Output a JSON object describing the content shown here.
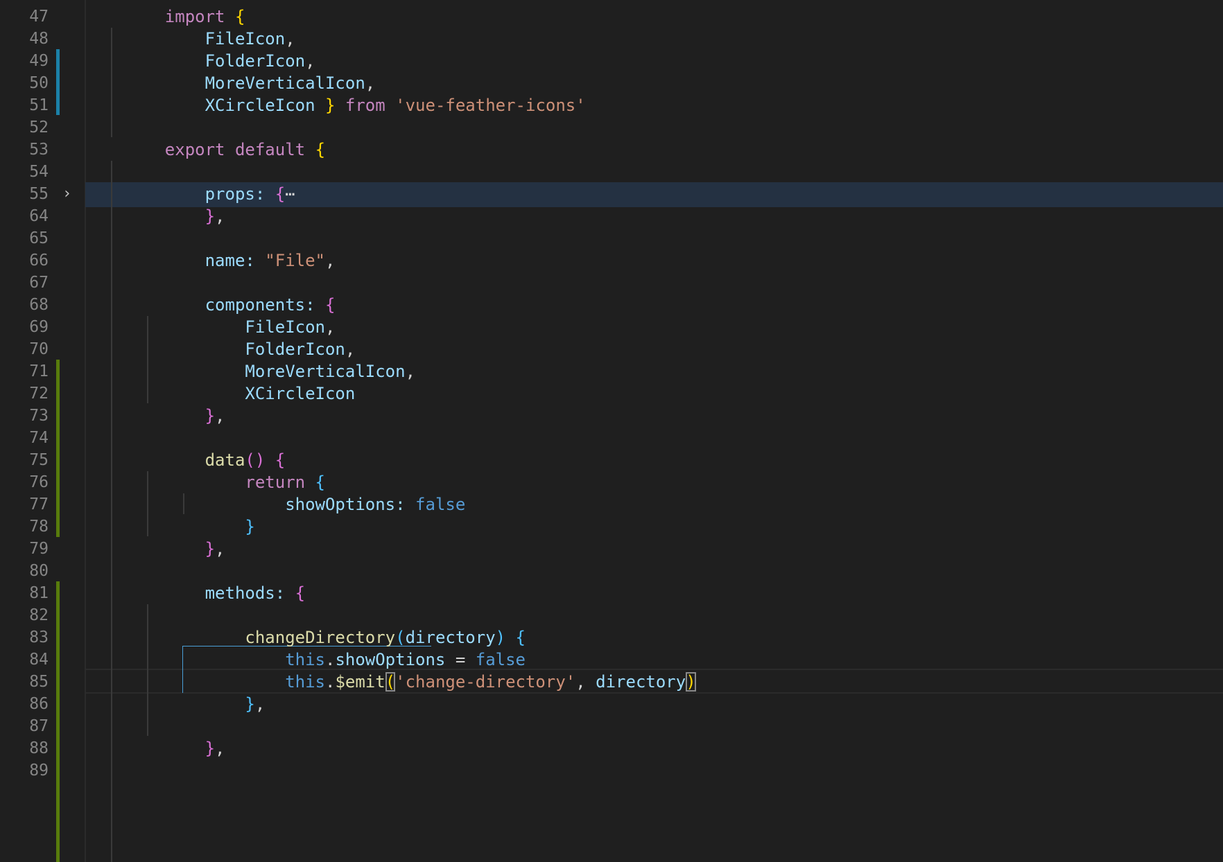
{
  "editor": {
    "colors": {
      "background": "#1f1f1f",
      "line_number": "#858585",
      "change_modified": "#1b81a8",
      "change_added": "#587c0c",
      "highlight": "#243142"
    },
    "lines": [
      {
        "n": "47",
        "tokens": [
          [
            "    ",
            "w"
          ],
          [
            "import",
            "p"
          ],
          [
            " ",
            "w"
          ],
          [
            "{",
            "y"
          ]
        ]
      },
      {
        "n": "48",
        "tokens": [
          [
            "        ",
            "w"
          ],
          [
            "FileIcon",
            "b"
          ],
          [
            ",",
            "w"
          ]
        ]
      },
      {
        "n": "49",
        "tokens": [
          [
            "        ",
            "w"
          ],
          [
            "FolderIcon",
            "b"
          ],
          [
            ",",
            "w"
          ]
        ]
      },
      {
        "n": "50",
        "tokens": [
          [
            "        ",
            "w"
          ],
          [
            "MoreVerticalIcon",
            "b"
          ],
          [
            ",",
            "w"
          ]
        ]
      },
      {
        "n": "51",
        "tokens": [
          [
            "        ",
            "w"
          ],
          [
            "XCircleIcon",
            "b"
          ],
          [
            " ",
            "w"
          ],
          [
            "}",
            "y"
          ],
          [
            " ",
            "w"
          ],
          [
            "from",
            "p"
          ],
          [
            " ",
            "w"
          ],
          [
            "'vue-feather-icons'",
            "o"
          ]
        ]
      },
      {
        "n": "52",
        "tokens": []
      },
      {
        "n": "53",
        "tokens": [
          [
            "    ",
            "w"
          ],
          [
            "export",
            "p"
          ],
          [
            " ",
            "w"
          ],
          [
            "default",
            "p"
          ],
          [
            " ",
            "w"
          ],
          [
            "{",
            "y"
          ]
        ]
      },
      {
        "n": "54",
        "tokens": []
      },
      {
        "n": "55",
        "tokens": [
          [
            "        ",
            "w"
          ],
          [
            "props",
            "b"
          ],
          [
            ": ",
            "b"
          ],
          [
            "{",
            "pk"
          ],
          [
            "⋯",
            "w"
          ]
        ]
      },
      {
        "n": "64",
        "tokens": [
          [
            "        ",
            "w"
          ],
          [
            "}",
            "pk"
          ],
          [
            ",",
            "w"
          ]
        ]
      },
      {
        "n": "65",
        "tokens": []
      },
      {
        "n": "66",
        "tokens": [
          [
            "        ",
            "w"
          ],
          [
            "name",
            "b"
          ],
          [
            ": ",
            "b"
          ],
          [
            "\"File\"",
            "o"
          ],
          [
            ",",
            "w"
          ]
        ]
      },
      {
        "n": "67",
        "tokens": []
      },
      {
        "n": "68",
        "tokens": [
          [
            "        ",
            "w"
          ],
          [
            "components",
            "b"
          ],
          [
            ": ",
            "b"
          ],
          [
            "{",
            "pk"
          ]
        ]
      },
      {
        "n": "69",
        "tokens": [
          [
            "            ",
            "w"
          ],
          [
            "FileIcon",
            "b"
          ],
          [
            ",",
            "w"
          ]
        ]
      },
      {
        "n": "70",
        "tokens": [
          [
            "            ",
            "w"
          ],
          [
            "FolderIcon",
            "b"
          ],
          [
            ",",
            "w"
          ]
        ]
      },
      {
        "n": "71",
        "tokens": [
          [
            "            ",
            "w"
          ],
          [
            "MoreVerticalIcon",
            "b"
          ],
          [
            ",",
            "w"
          ]
        ]
      },
      {
        "n": "72",
        "tokens": [
          [
            "            ",
            "w"
          ],
          [
            "XCircleIcon",
            "b"
          ]
        ]
      },
      {
        "n": "73",
        "tokens": [
          [
            "        ",
            "w"
          ],
          [
            "}",
            "pk"
          ],
          [
            ",",
            "w"
          ]
        ]
      },
      {
        "n": "74",
        "tokens": []
      },
      {
        "n": "75",
        "tokens": [
          [
            "        ",
            "w"
          ],
          [
            "data",
            "f"
          ],
          [
            "()",
            "pk"
          ],
          [
            " ",
            "w"
          ],
          [
            "{",
            "pk"
          ]
        ]
      },
      {
        "n": "76",
        "tokens": [
          [
            "            ",
            "w"
          ],
          [
            "return",
            "p"
          ],
          [
            " ",
            "w"
          ],
          [
            "{",
            "cb"
          ]
        ]
      },
      {
        "n": "77",
        "tokens": [
          [
            "                ",
            "w"
          ],
          [
            "showOptions",
            "b"
          ],
          [
            ": ",
            "b"
          ],
          [
            "false",
            "bo"
          ]
        ]
      },
      {
        "n": "78",
        "tokens": [
          [
            "            ",
            "w"
          ],
          [
            "}",
            "cb"
          ]
        ]
      },
      {
        "n": "79",
        "tokens": [
          [
            "        ",
            "w"
          ],
          [
            "}",
            "pk"
          ],
          [
            ",",
            "w"
          ]
        ]
      },
      {
        "n": "80",
        "tokens": []
      },
      {
        "n": "81",
        "tokens": [
          [
            "        ",
            "w"
          ],
          [
            "methods",
            "b"
          ],
          [
            ": ",
            "b"
          ],
          [
            "{",
            "pk"
          ]
        ]
      },
      {
        "n": "82",
        "tokens": []
      },
      {
        "n": "83",
        "tokens": [
          [
            "            ",
            "w"
          ],
          [
            "changeDirectory",
            "f"
          ],
          [
            "(",
            "cb"
          ],
          [
            "directory",
            "b"
          ],
          [
            ")",
            "cb"
          ],
          [
            " ",
            "w"
          ],
          [
            "{",
            "cb"
          ]
        ]
      },
      {
        "n": "84",
        "tokens": [
          [
            "                ",
            "w"
          ],
          [
            "this",
            "bo"
          ],
          [
            ".",
            "w"
          ],
          [
            "showOptions",
            "b"
          ],
          [
            " = ",
            "w"
          ],
          [
            "false",
            "bo"
          ]
        ]
      },
      {
        "n": "85",
        "tokens": [
          [
            "                ",
            "w"
          ],
          [
            "this",
            "bo"
          ],
          [
            ".",
            "w"
          ],
          [
            "$emit",
            "f"
          ],
          [
            "(",
            "ybox"
          ],
          [
            "'change-directory'",
            "o"
          ],
          [
            ", ",
            "w"
          ],
          [
            "directory",
            "b"
          ],
          [
            ")",
            "ybox"
          ]
        ]
      },
      {
        "n": "86",
        "tokens": [
          [
            "            ",
            "w"
          ],
          [
            "}",
            "cb"
          ],
          [
            ",",
            "w"
          ]
        ]
      },
      {
        "n": "87",
        "tokens": []
      },
      {
        "n": "88",
        "tokens": [
          [
            "        ",
            "w"
          ],
          [
            "}",
            "pk"
          ],
          [
            ",",
            "w"
          ]
        ]
      },
      {
        "n": "89",
        "tokens": []
      }
    ]
  }
}
